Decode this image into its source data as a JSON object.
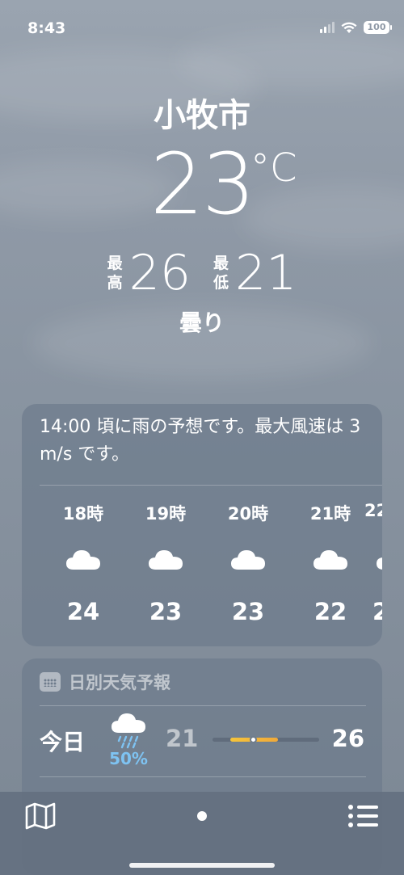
{
  "status_bar": {
    "time": "8:43",
    "battery": "100"
  },
  "location": {
    "city": "小牧市"
  },
  "current": {
    "temperature": "23",
    "unit": "°C",
    "high_label_1": "最",
    "high_label_2": "高",
    "high": "26",
    "low_label_1": "最",
    "low_label_2": "低",
    "low": "21",
    "condition": "曇り"
  },
  "hourly": {
    "summary": "14:00 頃に雨の予想です。最大風速は 3 m/s です。",
    "items": [
      {
        "time": "18時",
        "icon": "cloud-icon",
        "temp": "24"
      },
      {
        "time": "19時",
        "icon": "cloud-icon",
        "temp": "23"
      },
      {
        "time": "20時",
        "icon": "cloud-icon",
        "temp": "23"
      },
      {
        "time": "21時",
        "icon": "cloud-icon",
        "temp": "22"
      },
      {
        "time": "22",
        "icon": "cloud-icon",
        "temp": "2"
      }
    ]
  },
  "daily": {
    "header": "日別天気予報",
    "header_icon": "calendar-icon",
    "days": [
      {
        "day": "今日",
        "icon": "cloud-rain-icon",
        "precip": "50%",
        "low": "21",
        "high": "26",
        "range_start": 0.17,
        "range_end": 0.61,
        "current": 0.38
      }
    ]
  },
  "colors": {
    "precip": "#7ec3f2",
    "temp_bar_start": "#f5c43a",
    "temp_bar_end": "#f0a93a"
  }
}
